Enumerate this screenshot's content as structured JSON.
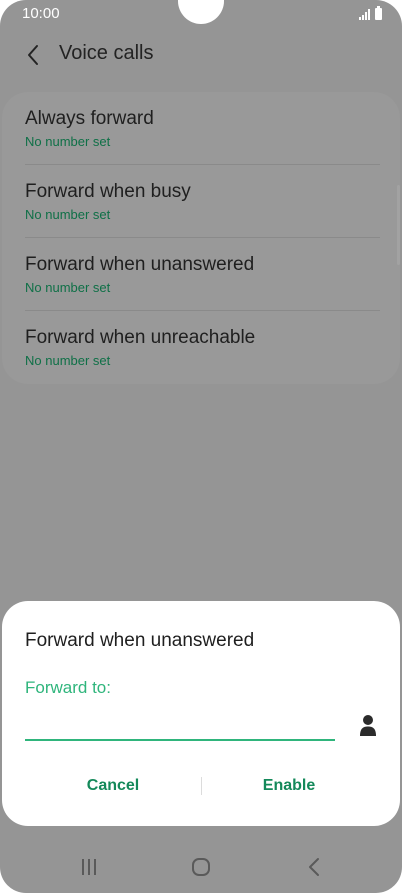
{
  "status_bar": {
    "time": "10:00"
  },
  "header": {
    "title": "Voice calls",
    "back_icon": "chevron-left-icon"
  },
  "settings": {
    "items": [
      {
        "title": "Always forward",
        "subtitle": "No number set"
      },
      {
        "title": "Forward when busy",
        "subtitle": "No number set"
      },
      {
        "title": "Forward when unanswered",
        "subtitle": "No number set"
      },
      {
        "title": "Forward when unreachable",
        "subtitle": "No number set"
      }
    ]
  },
  "dialog": {
    "title": "Forward when unanswered",
    "field_label": "Forward to:",
    "field_value": "",
    "contact_icon": "person-icon",
    "cancel_label": "Cancel",
    "enable_label": "Enable"
  },
  "nav": {
    "recents_icon": "recents-icon",
    "home_icon": "home-icon",
    "back_icon": "back-icon"
  },
  "colors": {
    "accent": "#2fb57c",
    "button_text": "#14895a",
    "subtitle_text": "#0f7047",
    "scrim_background": "#959595",
    "dialog_background": "#ffffff"
  }
}
